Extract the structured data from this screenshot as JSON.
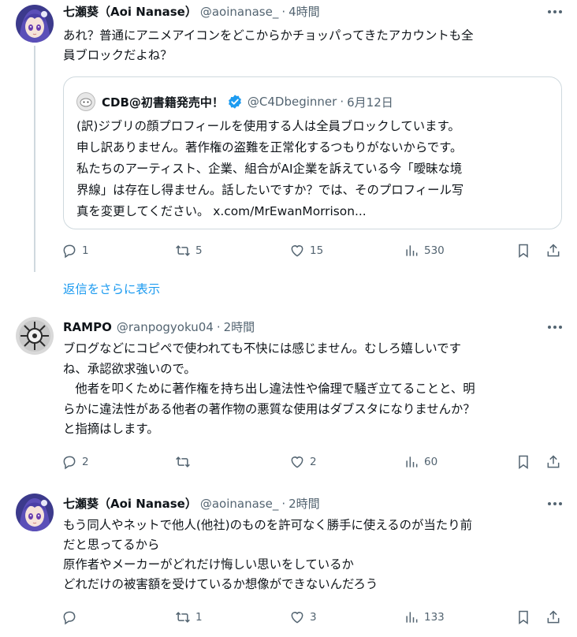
{
  "tweets": [
    {
      "name": "七瀬葵（Aoi Nanase）",
      "handle": "@aoinanase_",
      "time": "4時間",
      "text": "あれ？普通にアニメアイコンをどこからかチョッパってきたアカウントも全\n員ブロックだよね？",
      "quote": {
        "name": "CDB@初書籍発売中！",
        "handle": "@C4Dbeginner",
        "time": "6月12日",
        "text": "(訳)ジブリの顔プロフィールを使用する人は全員ブロックしています。\n申し訳ありません。著作権の盗難を正常化するつもりがないからです。\n私たちのアーティスト、企業、組合がAI企業を訴えている今「曖昧な境\n界線」は存在し得ません。話したいですか？では、そのプロフィール写\n真を変更してください。 ",
        "link": "x.com/MrEwanMorrison..."
      },
      "stats": {
        "replies": "1",
        "retweets": "5",
        "likes": "15",
        "views": "530"
      }
    },
    {
      "name": "RAMPO",
      "handle": "@ranpogyoku04",
      "time": "2時間",
      "text": "ブログなどにコピペで使われても不快には感じません。むしろ嬉しいです\nね、承認欲求強いので。\n　他者を叩くために著作権を持ち出し違法性や倫理で騒ぎ立てることと、明\nらかに違法性がある他者の著作物の悪質な使用はダブスタになりませんか？\nと指摘はします。",
      "stats": {
        "replies": "2",
        "retweets": "",
        "likes": "2",
        "views": "60"
      }
    },
    {
      "name": "七瀬葵（Aoi Nanase）",
      "handle": "@aoinanase_",
      "time": "2時間",
      "text": "もう同人やネットで他人(他社)のものを許可なく勝手に使えるのが当たり前\nだと思ってるから\n原作者やメーカーがどれだけ悔しい思いをしているか\nどれだけの被害額を受けているか想像ができないんだろう",
      "stats": {
        "replies": "",
        "retweets": "1",
        "likes": "3",
        "views": "133"
      }
    }
  ],
  "show_more": "返信をさらに表示",
  "separator": "·",
  "icons": [
    "reply-icon",
    "retweet-icon",
    "like-icon",
    "views-icon",
    "bookmark-icon",
    "share-icon",
    "more-icon",
    "verified-icon"
  ],
  "colors": {
    "link": "#1d9bf0",
    "muted": "#536471",
    "text": "#0f1419",
    "border": "#cfd9de",
    "verified": "#1d9bf0"
  }
}
